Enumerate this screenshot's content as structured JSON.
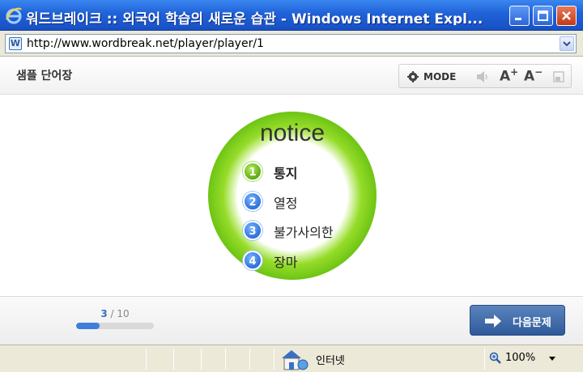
{
  "window": {
    "title": "워드브레이크 :: 외국어 학습의 새로운 습관 - Windows Internet Expl..."
  },
  "address_bar": {
    "url": "http://www.wordbreak.net/player/player/1",
    "favicon_letter": "W"
  },
  "header": {
    "title": "샘플 단어장",
    "mode_label": "MODE",
    "font_increase_label": "A",
    "font_decrease_label": "A"
  },
  "quiz": {
    "word": "notice",
    "choices": [
      {
        "number": "1",
        "text": "통지",
        "selected": true
      },
      {
        "number": "2",
        "text": "열정",
        "selected": false
      },
      {
        "number": "3",
        "text": "불가사의한",
        "selected": false
      },
      {
        "number": "4",
        "text": "장마",
        "selected": false
      }
    ]
  },
  "progress": {
    "current": "3",
    "separator": " / ",
    "total": "10",
    "fraction": 0.3
  },
  "footer": {
    "next_label": "다음문제"
  },
  "statusbar": {
    "zone_label": "인터넷",
    "zoom_label": "100%"
  },
  "colors": {
    "titlebar": "#1f62d8",
    "ring_green": "#6fc515",
    "selected_choice": "#5ea80f",
    "choice_blue": "#2e6fdb",
    "next_button": "#2e5a9a",
    "progress_fill": "#3f7fd9"
  }
}
